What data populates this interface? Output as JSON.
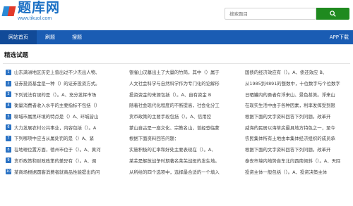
{
  "header": {
    "logo_cn": "题库网",
    "logo_en": "www.tikuol.com",
    "search_placeholder": "搜索题目"
  },
  "nav": {
    "items": [
      {
        "label": "网站首页"
      },
      {
        "label": "刷题"
      },
      {
        "label": "搜题"
      }
    ],
    "app_download": "APP下载"
  },
  "main": {
    "section_title": "精选试题",
    "rows": [
      {
        "num": "1",
        "c1": "山东满洲地区历史上曾出过不少杰出人物、",
        "c2": "银雀山汉墓出土了大量的竹简，其中（）属于",
        "c3": "国债的经济效应有（）。A、债还效应 B、"
      },
      {
        "num": "2",
        "c1": "证券投资基金是一种（）的证券投资方式。",
        "c2": "人文社会科学与自然科学作为专门化的论解形",
        "c3": "从1985到4891的整数中，十位数字与个位数字"
      },
      {
        "num": "3",
        "c1": "下列说法有误的是（）。A、充分发挥市场",
        "c2": "投资资金的来源包括（）。A、自有资金 B",
        "c3": "日晒罐内的勇者有浮来山、景色甚美。浮来山"
      },
      {
        "num": "4",
        "c1": "衡量消费者收入水平的主要指标不包括（）",
        "c2": "随着社会现代化程度的不断提高，社会化分工",
        "c3": "在现实生活中由于各种因素，利率发挥受到限"
      },
      {
        "num": "5",
        "c1": "聊城市属黑环境的特点是（）A、环城皆山",
        "c2": "货币政策的主要手段包括（）。A、信用控",
        "c3": "根据下面的文字资料回答下列问题。改革开"
      },
      {
        "num": "6",
        "c1": "大力发展农村公共事业，内容包括（）。A",
        "c2": "蒙山自古是一座文化、宗教名山，曾经登临蒙",
        "c3": "威海的民居以海草房最具地方特色之一，至今"
      },
      {
        "num": "7",
        "c1": "下列哪项中应当从属处罚的是（）A、紧",
        "c2": "根据下面资料回答问题：",
        "c3": "农民集体所有土地由本集体经济组织的成员承"
      },
      {
        "num": "8",
        "c1": "在地理位置方面，德州市位于（）。A、黄河",
        "c2": "实施积极的汇率和好处主要表现在（）。A、",
        "c3": "根据下面的文字资料回答下列问题。改革开"
      },
      {
        "num": "9",
        "c1": "货币政策和财政政策的差异有（）。A、调",
        "c2": "莱芜是解放战争时期著名莱芜战役的发生地。",
        "c3": "泰安市境内地势自东北向西南倾斜（）。A、天际"
      },
      {
        "num": "10",
        "c1": "某商场根据圆客消费者就商品性能提出的问",
        "c2": "从所给的四个选项中，选择最合适的一个填入",
        "c3": "投资主体一般包括（）。A、投资决策主体"
      }
    ]
  }
}
